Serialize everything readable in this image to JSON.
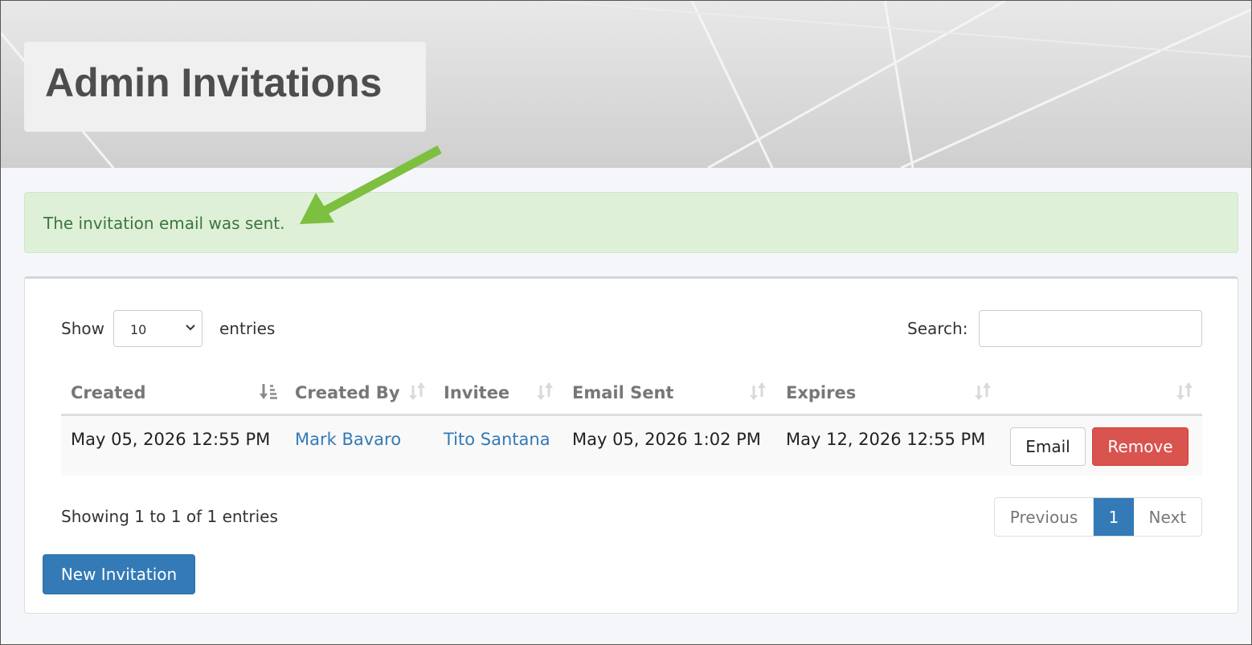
{
  "header": {
    "title": "Admin Invitations"
  },
  "alert": {
    "message": "The invitation email was sent."
  },
  "table_controls": {
    "show_label": "Show",
    "page_length": "10",
    "entries_label": "entries",
    "search_label": "Search:",
    "search_value": ""
  },
  "table": {
    "columns": [
      "Created",
      "Created By",
      "Invitee",
      "Email Sent",
      "Expires",
      ""
    ],
    "rows": [
      {
        "created": "May 05, 2026 12:55 PM",
        "created_by": "Mark Bavaro",
        "invitee": "Tito Santana",
        "email_sent": "May 05, 2026 1:02 PM",
        "expires": "May 12, 2026 12:55 PM",
        "email_button": "Email",
        "remove_button": "Remove"
      }
    ]
  },
  "footer": {
    "info": "Showing 1 to 1 of 1 entries",
    "pagination": {
      "previous": "Previous",
      "current": "1",
      "next": "Next"
    },
    "new_button": "New Invitation"
  },
  "colors": {
    "alert_bg": "#dff0d8",
    "alert_text": "#3c763d",
    "primary": "#337ab7",
    "danger": "#d9534f",
    "annotation_arrow": "#7dbf3f"
  },
  "icons": {
    "sort_active": "sort-desc-icon",
    "sort_inactive": "sort-both-icon",
    "select_chevron": "chevron-down-icon",
    "annotation": "arrow-icon"
  }
}
